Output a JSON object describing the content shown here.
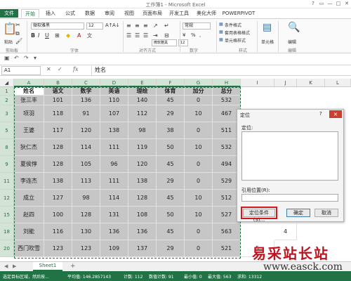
{
  "window": {
    "title": "工作簿1 - Microsoft Excel"
  },
  "tabs": [
    {
      "label": "文件"
    },
    {
      "label": "开始"
    },
    {
      "label": "插入"
    },
    {
      "label": "公式"
    },
    {
      "label": "数据"
    },
    {
      "label": "审阅"
    },
    {
      "label": "视图"
    },
    {
      "label": "页面布局"
    },
    {
      "label": "开发工具"
    },
    {
      "label": "美化大师"
    },
    {
      "label": "POWERPIVOT"
    }
  ],
  "ribbon": {
    "paste": "粘贴",
    "clipboard": "剪贴板",
    "font_name": "微软雅黑",
    "font_size": "12",
    "font_group": "字体",
    "align_group": "对齐方式",
    "number_format": "常规",
    "number_group": "数字",
    "cond_format": "条件格式",
    "table_format": "套用表格格式",
    "cell_style": "单元格样式",
    "styles_group": "样式",
    "cells": "单元格",
    "edit": "编辑",
    "edit_group": "编辑",
    "font_name2": "微软雅黑",
    "font_size2": "12"
  },
  "formula_bar": {
    "name_box": "A1",
    "fx": "fx",
    "value": "姓名"
  },
  "columns": [
    "A",
    "B",
    "C",
    "D",
    "E",
    "F",
    "G",
    "H",
    "I",
    "J",
    "K",
    "L"
  ],
  "rows": [
    "1",
    "2",
    "3",
    "5",
    "8",
    "9",
    "11",
    "12",
    "15",
    "18",
    "20"
  ],
  "table": {
    "headers": [
      "姓名",
      "语文",
      "数学",
      "英语",
      "理绘",
      "体育",
      "加分",
      "总分"
    ],
    "rows": [
      [
        "张三丰",
        "101",
        "136",
        "110",
        "140",
        "45",
        "0",
        "532"
      ],
      [
        "项羽",
        "118",
        "91",
        "107",
        "112",
        "29",
        "10",
        "467"
      ],
      [
        "王婆",
        "117",
        "120",
        "138",
        "98",
        "38",
        "0",
        "511"
      ],
      [
        "狄仁杰",
        "128",
        "114",
        "111",
        "119",
        "50",
        "10",
        "532"
      ],
      [
        "夏侯惇",
        "128",
        "105",
        "96",
        "120",
        "45",
        "0",
        "494"
      ],
      [
        "李连杰",
        "138",
        "113",
        "111",
        "138",
        "29",
        "0",
        "529"
      ],
      [
        "成立",
        "127",
        "98",
        "114",
        "128",
        "45",
        "10",
        "512"
      ],
      [
        "赵四",
        "100",
        "128",
        "131",
        "108",
        "50",
        "10",
        "527"
      ],
      [
        "刘能",
        "116",
        "130",
        "136",
        "136",
        "45",
        "0",
        "563"
      ],
      [
        "西门吹雪",
        "123",
        "123",
        "109",
        "137",
        "29",
        "0",
        "521"
      ]
    ]
  },
  "extra_cells": {
    "j18": "4",
    "i20": "5"
  },
  "dialog": {
    "title": "定位",
    "help": "?",
    "close": "×",
    "list_label": "定位:",
    "ref_label": "引用位置(R):",
    "special_btn": "定位条件(S)...",
    "ok_btn": "确定",
    "cancel_btn": "取消"
  },
  "sheet_tab": "Sheet1",
  "add_sheet": "+",
  "status": {
    "mode": "选定目标区域，然后按...",
    "average": "平均值: 146.2857143",
    "count": "计数: 112",
    "num_count": "数值计数: 91",
    "min": "最小值: 0",
    "max": "最大值: 563",
    "sum": "求和: 13312"
  },
  "watermark": {
    "big": "易采站长站",
    "small": "www.easck.com"
  }
}
